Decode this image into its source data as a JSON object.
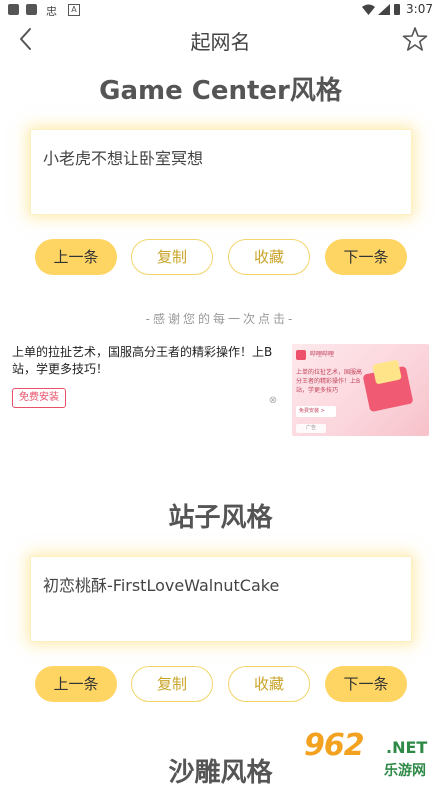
{
  "status_bar": {
    "app_glyph": "忠",
    "a_glyph": "A",
    "time": "3:07"
  },
  "nav": {
    "title": "起网名"
  },
  "sections": [
    {
      "title": "Game Center风格",
      "name": "小老虎不想让卧室冥想",
      "buttons": {
        "prev": "上一条",
        "copy": "复制",
        "favorite": "收藏",
        "next": "下一条"
      }
    },
    {
      "title": "站子风格",
      "name": "初恋桃酥-FirstLoveWalnutCake",
      "buttons": {
        "prev": "上一条",
        "copy": "复制",
        "favorite": "收藏",
        "next": "下一条"
      }
    },
    {
      "title": "沙雕风格"
    }
  ],
  "thanks_text": "-感谢您的每一次点击-",
  "ad": {
    "text": "上单的拉扯艺术，国服高分王者的精彩操作！上B站，学更多技巧！",
    "install_label": "免费安装",
    "close_glyph": "⊗",
    "image_brand": "哔哩哔哩",
    "image_text": "上单的拉扯艺术，国服高分王者的精彩操作！上B站，学更多技巧",
    "image_button": "免费安装 >",
    "image_corner": "广告"
  },
  "watermark": {
    "logo_number": "962",
    "logo_net": ".NET",
    "logo_sub": "乐游网"
  },
  "colors": {
    "accent_yellow": "#fed563",
    "outline_gold": "#f3d56a",
    "ad_pink": "#e8506a",
    "watermark_orange": "#f3a21f",
    "watermark_green": "#2f8a47"
  },
  "icons": {
    "back": "chevron-left-icon",
    "favorite": "star-outline-icon",
    "wifi": "wifi-icon",
    "signal": "signal-icon",
    "battery": "battery-icon"
  }
}
